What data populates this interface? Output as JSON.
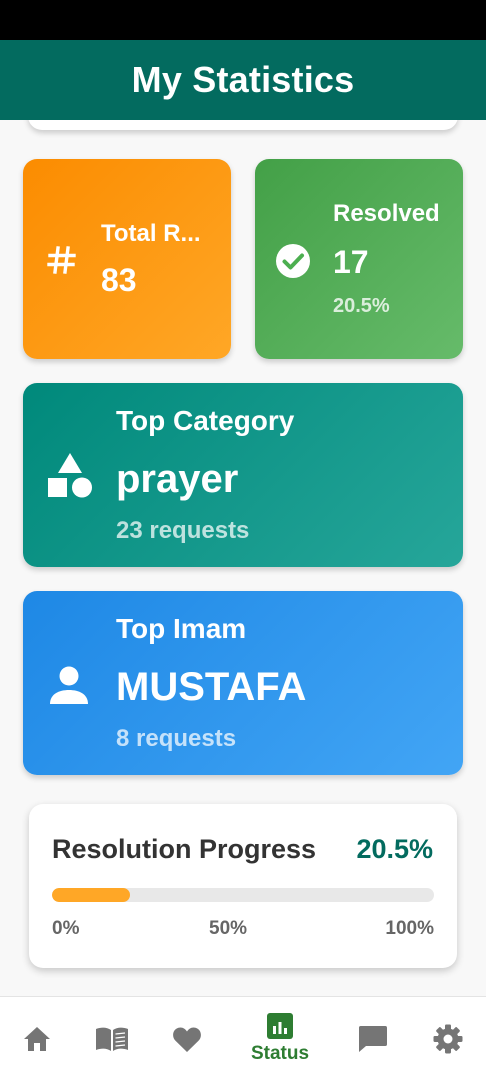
{
  "header": {
    "title": "My Statistics"
  },
  "cards": {
    "total": {
      "label": "Total R...",
      "value": "83"
    },
    "resolved": {
      "label": "Resolved",
      "value": "17",
      "percent": "20.5%"
    },
    "top_category": {
      "label": "Top Category",
      "value": "prayer",
      "sub": "23 requests"
    },
    "top_imam": {
      "label": "Top Imam",
      "value": "MUSTAFA",
      "sub": "8 requests"
    }
  },
  "progress": {
    "title": "Resolution Progress",
    "percent_label": "20.5%",
    "value": 0.205,
    "ticks": [
      "0%",
      "50%",
      "100%"
    ]
  },
  "bottom_nav": {
    "items": [
      {
        "icon": "home-icon",
        "label": ""
      },
      {
        "icon": "book-icon",
        "label": ""
      },
      {
        "icon": "heart-icon",
        "label": ""
      },
      {
        "icon": "bar-chart-icon",
        "label": "Status",
        "active": true
      },
      {
        "icon": "chat-icon",
        "label": ""
      },
      {
        "icon": "gear-icon",
        "label": ""
      }
    ]
  },
  "colors": {
    "header": "#036b5f",
    "total_card": "#fb8c00",
    "resolved_card": "#43a047",
    "category_card": "#00897b",
    "imam_card": "#1e88e5",
    "progress_fill": "#ffa726",
    "nav_active": "#2e7d32",
    "nav_inactive": "#757575"
  }
}
